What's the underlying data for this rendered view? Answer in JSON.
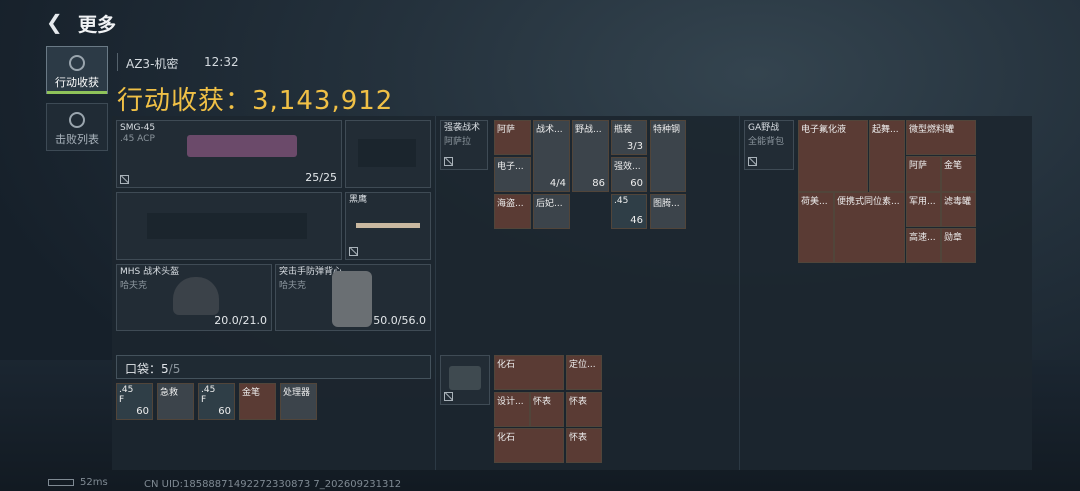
{
  "header": {
    "back_icon": "arrow-left-icon",
    "title": "更多"
  },
  "tabs": [
    {
      "label": "行动收获",
      "active": true,
      "icon": "target-icon"
    },
    {
      "label": "击败列表",
      "active": false,
      "icon": "skull-icon"
    }
  ],
  "info": {
    "map": "AZ3-机密",
    "time": "12:32"
  },
  "haul": {
    "label": "行动收获：",
    "value": "3,143,912"
  },
  "weapon": {
    "name": "SMG-45",
    "ammo": ".45 ACP",
    "count": "25/25"
  },
  "melee": {
    "name": "黑鹰"
  },
  "helmet": {
    "name": "MHS 战术头盔",
    "brand": "哈夫克",
    "durability": "20.0/21.0"
  },
  "vest": {
    "name": "突击手防弹背心",
    "brand": "哈夫克",
    "durability": "50.0/56.0"
  },
  "pocket": {
    "label": "口袋：",
    "value": "5",
    "max": "/5"
  },
  "pocket_items": [
    {
      "name": ".45",
      "sub": "F",
      "count": "60"
    },
    {
      "name": "急救",
      "count": ""
    },
    {
      "name": ".45",
      "sub": "F",
      "count": "60"
    },
    {
      "name": "金笔",
      "count": ""
    },
    {
      "name": "处理器",
      "count": ""
    }
  ],
  "chest": {
    "name": "强袭战术",
    "sub": "阿萨拉"
  },
  "chest_items": [
    {
      "name": "阿萨",
      "count": ""
    },
    {
      "name": "战术...",
      "count": "4/4"
    },
    {
      "name": "野战...",
      "count": "86"
    },
    {
      "name": "瓶装",
      "count": "3/3"
    },
    {
      "name": "特种钢",
      "count": ""
    },
    {
      "name": "电子...",
      "count": ""
    },
    {
      "name": "强效...",
      "count": "60"
    },
    {
      "name": "海盗...",
      "count": ""
    },
    {
      "name": "后妃...",
      "count": ""
    },
    {
      "name": ".45",
      "count": "46"
    },
    {
      "name": "图腾...",
      "count": ""
    }
  ],
  "backpack": {
    "name": "GA野战",
    "sub": "全能背包"
  },
  "backpack_items": [
    {
      "name": "电子氟化液",
      "count": ""
    },
    {
      "name": "起舞...",
      "count": ""
    },
    {
      "name": "微型燃料罐",
      "count": ""
    },
    {
      "name": "阿萨",
      "count": ""
    },
    {
      "name": "金笔",
      "count": ""
    },
    {
      "name": "荷美...",
      "count": ""
    },
    {
      "name": "便携式同位素...",
      "count": ""
    },
    {
      "name": "军用...",
      "count": ""
    },
    {
      "name": "滤毒罐",
      "count": ""
    },
    {
      "name": "高速...",
      "count": ""
    },
    {
      "name": "勋章",
      "count": ""
    }
  ],
  "case_items": [
    {
      "name": "化石",
      "count": ""
    },
    {
      "name": "定位...",
      "count": ""
    },
    {
      "name": "设计...",
      "count": ""
    },
    {
      "name": "怀表",
      "count": ""
    },
    {
      "name": "怀表",
      "count": ""
    },
    {
      "name": "化石",
      "count": ""
    },
    {
      "name": "怀表",
      "count": ""
    }
  ],
  "footer": {
    "ping": "52ms",
    "uid": "CN UID:18588871492272330873 7_202609231312"
  },
  "colors": {
    "accent": "#f0c046",
    "rare_red": "#5a3b34"
  }
}
